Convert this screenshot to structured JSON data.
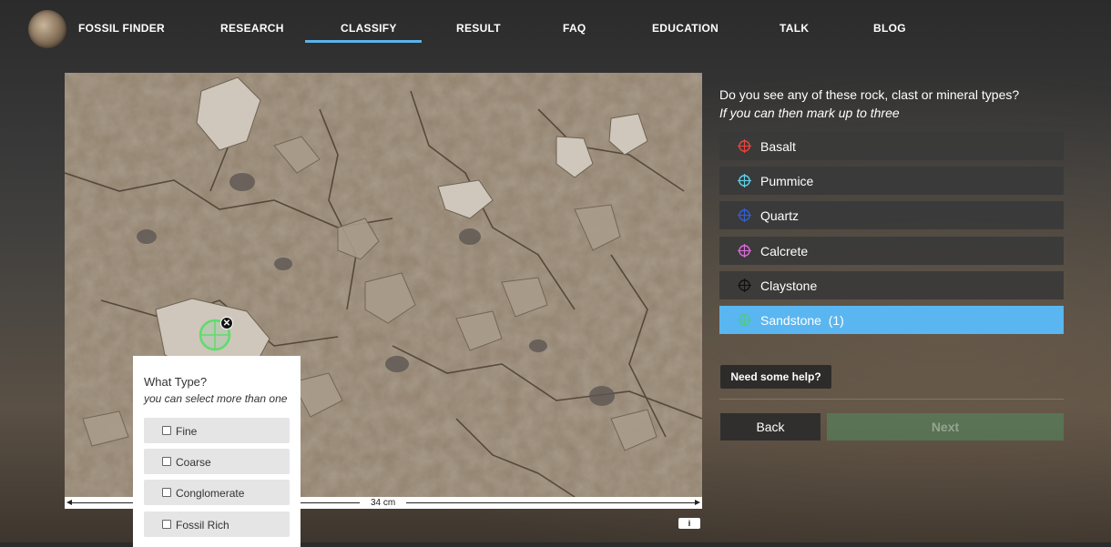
{
  "nav": {
    "brand": "FOSSIL FINDER",
    "items": [
      {
        "label": "RESEARCH"
      },
      {
        "label": "CLASSIFY",
        "active": true
      },
      {
        "label": "RESULT"
      },
      {
        "label": "FAQ"
      },
      {
        "label": "EDUCATION"
      },
      {
        "label": "TALK"
      },
      {
        "label": "BLOG"
      }
    ],
    "accent_color": "#5ab4e8"
  },
  "image": {
    "scale_label": "34 cm",
    "info_icon": "info-icon"
  },
  "popup": {
    "title": "What Type?",
    "subtitle": "you can select more than one",
    "options": [
      {
        "label": "Fine",
        "checked": false
      },
      {
        "label": "Coarse",
        "checked": false
      },
      {
        "label": "Conglomerate",
        "checked": false
      },
      {
        "label": "Fossil Rich",
        "checked": false
      }
    ]
  },
  "question": {
    "line1": "Do you see any of these rock, clast or mineral types?",
    "line2": "If you can then mark up to three"
  },
  "choices": [
    {
      "label": "Basalt",
      "icon": "crosshair-icon",
      "color": "#e8453c"
    },
    {
      "label": "Pummice",
      "icon": "crosshair-icon",
      "color": "#5fd0e6"
    },
    {
      "label": "Quartz",
      "icon": "crosshair-icon",
      "color": "#2f5fd8"
    },
    {
      "label": "Calcrete",
      "icon": "crosshair-icon",
      "color": "#d86ad8"
    },
    {
      "label": "Claystone",
      "icon": "crosshair-icon",
      "color": "#111111"
    },
    {
      "label": "Sandstone",
      "count": "(1)",
      "icon": "crosshair-icon",
      "color": "#4fc98a",
      "active": true
    }
  ],
  "help_label": "Need some help?",
  "back_label": "Back",
  "next_label": "Next"
}
